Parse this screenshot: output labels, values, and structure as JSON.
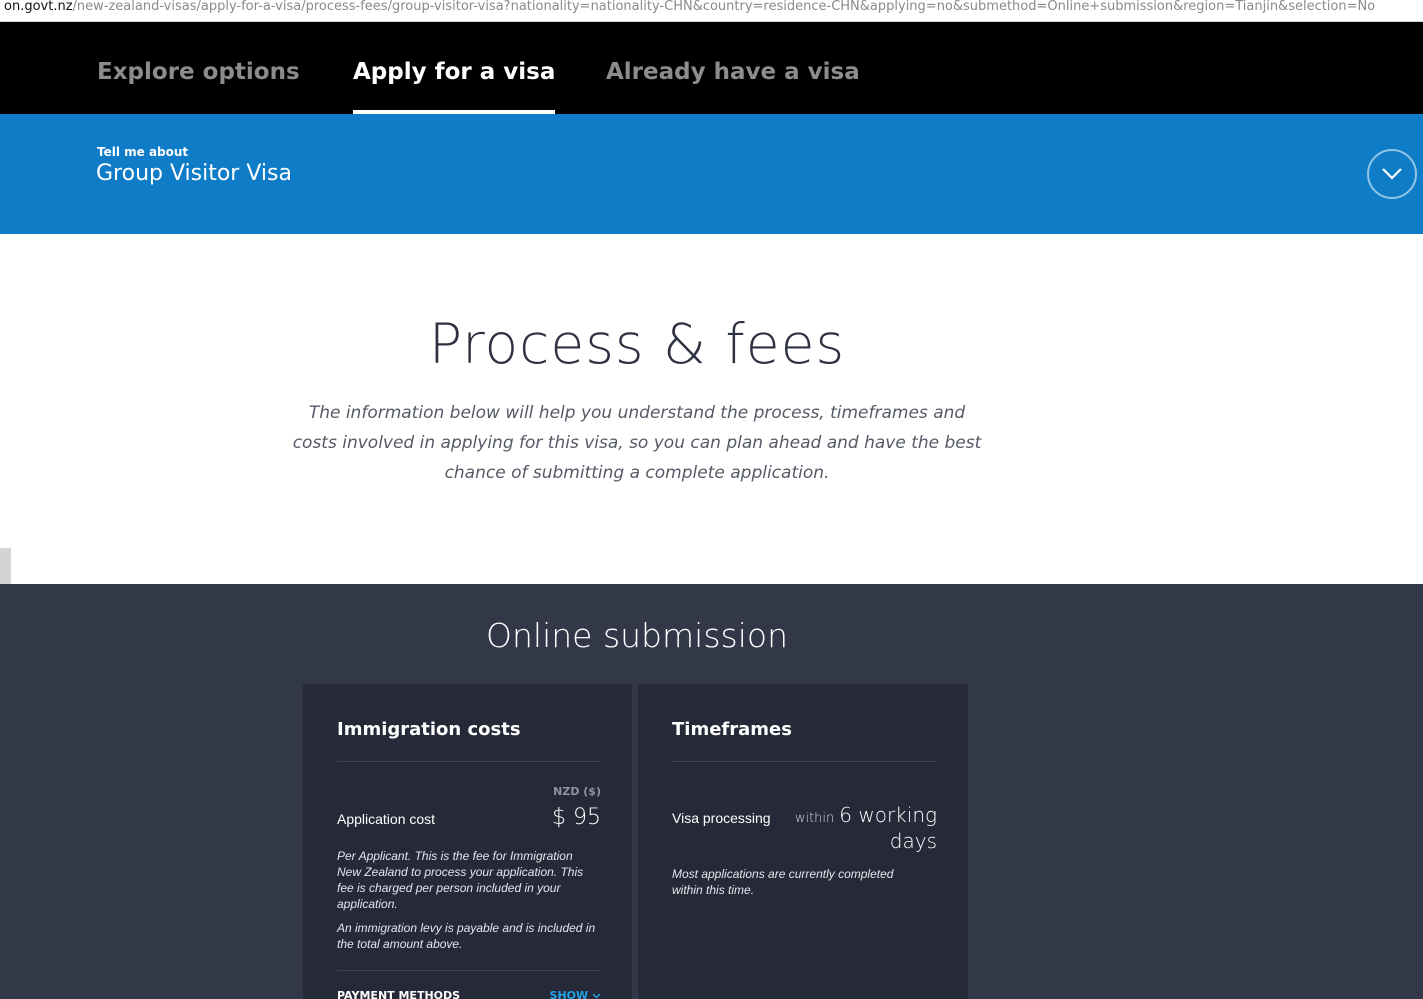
{
  "browser": {
    "url_host": "on.govt.nz",
    "url_path": "/new-zealand-visas/apply-for-a-visa/process-fees/group-visitor-visa?nationality=nationality-CHN&country=residence-CHN&applying=no&submethod=Online+submission&region=Tianjin&selection=No"
  },
  "nav": {
    "tabs": [
      {
        "label": "Explore options"
      },
      {
        "label": "Apply for a visa"
      },
      {
        "label": "Already have a visa"
      }
    ],
    "active_tab": "Apply for a visa"
  },
  "header": {
    "kicker": "Tell me about",
    "visa_name": "Group Visitor Visa",
    "expand_icon": "chevron-down-icon"
  },
  "intro": {
    "title": "Process & fees",
    "description": "The information below will help you understand the process, timeframes and costs involved in applying for this visa, so you can plan ahead and have the best chance of submitting a complete application."
  },
  "submission": {
    "title": "Online submission",
    "costs": {
      "heading": "Immigration costs",
      "currency_label": "NZD ($)",
      "row_label": "Application cost",
      "price": "$ 95",
      "note1": "Per Applicant. This is the fee for Immigration New Zealand to process your application. This fee is charged per person included in your application.",
      "note2": "An immigration levy is payable and is included in the total amount above.",
      "payment_methods_label": "PAYMENT METHODS",
      "show_label": "SHOW"
    },
    "timeframes": {
      "heading": "Timeframes",
      "row_label": "Visa processing",
      "within": "within",
      "value": "6 working days",
      "note": "Most applications are currently completed within this time."
    }
  },
  "colors": {
    "nav_bg": "#000000",
    "header_bg": "#0e7cc7",
    "dark_section_bg": "#333849",
    "card_bg": "#262a38",
    "link": "#1ea2e8"
  }
}
